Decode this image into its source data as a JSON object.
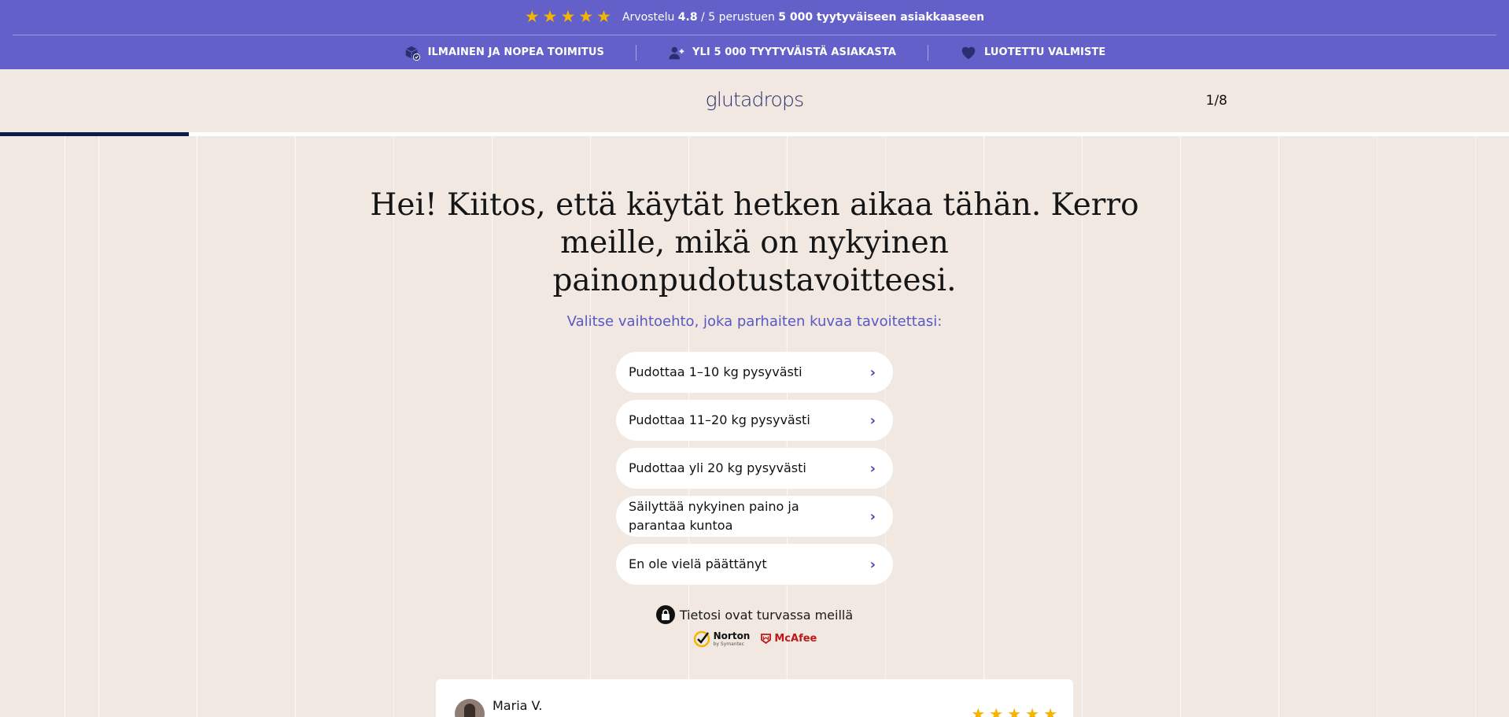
{
  "topbar": {
    "rating": {
      "star_count": 5,
      "star_color": "#f5b400",
      "prefix": "Arvostelu",
      "score": "4.8",
      "scale": "/ 5 perustuen",
      "count_text": "5 000 tyytyväiseen asiakkaaseen"
    },
    "background_color": "#6361c9",
    "usps": [
      {
        "icon": "delivery-box-icon",
        "label": "ILMAINEN JA NOPEA TOIMITUS"
      },
      {
        "icon": "user-plus-icon",
        "label": "YLI 5 000 TYYTYVÄISTÄ ASIAKASTA"
      },
      {
        "icon": "heart-icon",
        "label": "LUOTETTU VALMISTE"
      }
    ]
  },
  "header": {
    "logo": "glutadrops",
    "step": "1/8",
    "progress_fraction": 0.125,
    "progress_color": "#0b1d44"
  },
  "main": {
    "headline": "Hei! Kiitos, että käytät hetken aikaa tähän. Kerro meille, mikä on nykyinen painonpudotustavoitteesi.",
    "subline": "Valitse vaihtoehto, joka parhaiten kuvaa tavoitettasi:",
    "subline_color": "#5b57c4",
    "options": [
      {
        "label": "Pudottaa 1–10 kg pysyvästi"
      },
      {
        "label": "Pudottaa 11–20 kg pysyvästi"
      },
      {
        "label": "Pudottaa yli 20 kg pysyvästi"
      },
      {
        "label": "Säilyttää nykyinen paino ja parantaa kuntoa"
      },
      {
        "label": "En ole vielä päättänyt"
      }
    ],
    "option_icon": "chevron-right-icon"
  },
  "security": {
    "icon": "lock-icon",
    "text": "Tietosi ovat turvassa meillä",
    "badges": {
      "norton": "Norton",
      "norton_sub": "by Symantec",
      "mcafee": "McAfee"
    }
  },
  "review": {
    "name": "Maria V.",
    "star_count": 5
  }
}
